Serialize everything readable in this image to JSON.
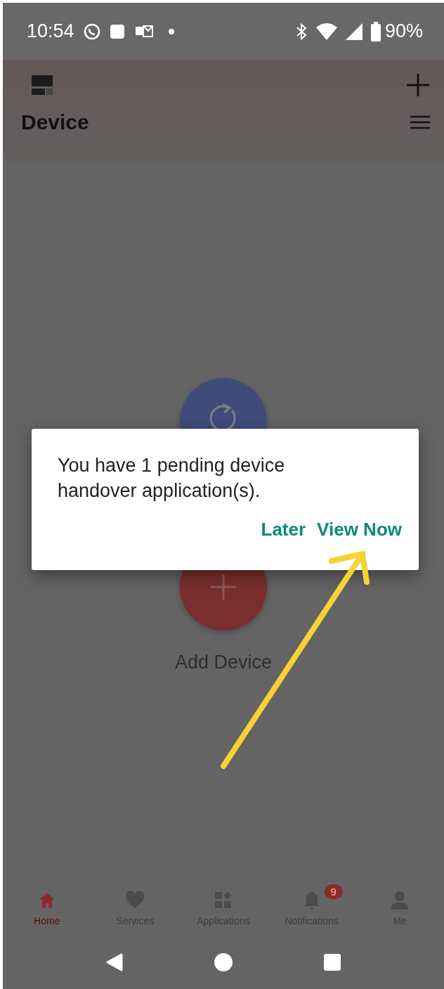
{
  "status_bar": {
    "time": "10:54",
    "battery": "90%"
  },
  "header": {
    "title": "Device"
  },
  "add_device": {
    "label": "Add Device"
  },
  "dialog": {
    "message": "You have 1 pending device handover application(s).",
    "buttons": [
      "Later",
      "View Now"
    ]
  },
  "bottom_nav": [
    {
      "label": "Home",
      "selected": true
    },
    {
      "label": "Services",
      "selected": false
    },
    {
      "label": "Applications",
      "selected": false
    },
    {
      "label": "Notifications",
      "selected": false,
      "badge": "9"
    },
    {
      "label": "Me",
      "selected": false
    }
  ]
}
